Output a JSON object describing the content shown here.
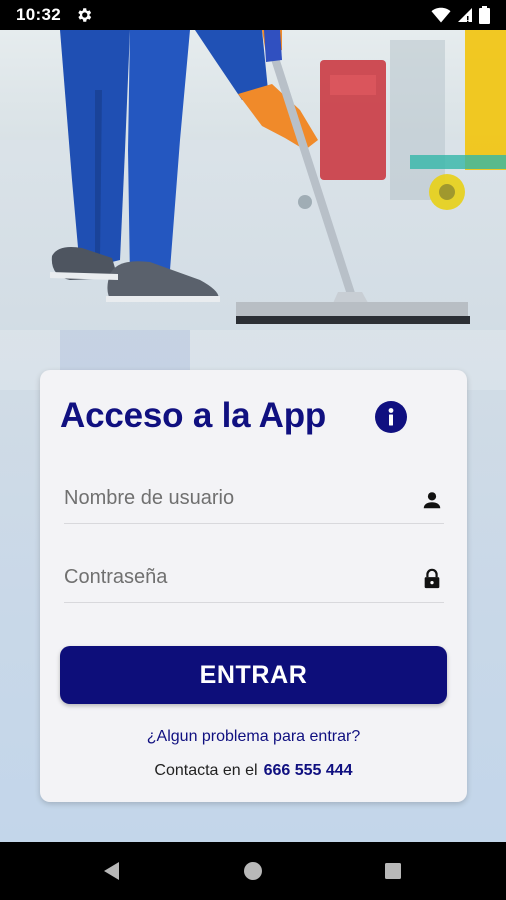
{
  "status_bar": {
    "time": "10:32",
    "icons": [
      "gear-icon",
      "wifi-icon",
      "signal-icon",
      "battery-icon"
    ]
  },
  "background": {
    "description_icon": "photo-icon"
  },
  "login_card": {
    "title": "Acceso a la App",
    "info_icon": "info-icon",
    "username": {
      "placeholder": "Nombre de usuario",
      "value": "",
      "icon": "person-icon"
    },
    "password": {
      "placeholder": "Contraseña",
      "value": "",
      "icon": "lock-icon"
    },
    "enter_label": "ENTRAR",
    "problem_link": "¿Algun problema para entrar?",
    "contact_text": "Contacta en el",
    "contact_phone": "666 555 444"
  },
  "nav_bar": {
    "icons": [
      "back-icon",
      "home-icon",
      "recents-icon"
    ]
  },
  "colors": {
    "brand": "#101080",
    "button": "#0d0e7a",
    "card_bg": "#f3f3f6"
  }
}
